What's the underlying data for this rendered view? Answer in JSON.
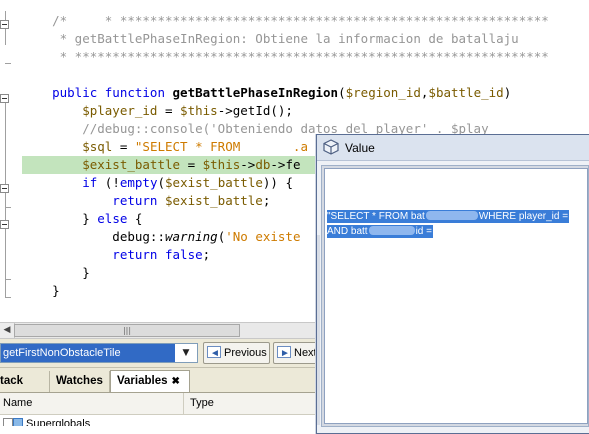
{
  "editor": {
    "lines": [
      {
        "tokens": [
          {
            "c": "cm",
            "t": "    /*     * ********************************************************************"
          }
        ]
      },
      {
        "tokens": [
          {
            "c": "cm",
            "t": "     * getBattlePhaseInRegion: Obtiene la informacion de batallaju"
          }
        ]
      },
      {
        "tokens": [
          {
            "c": "cm",
            "t": "     * ********************************************************************"
          }
        ]
      },
      {
        "tokens": [
          {
            "c": "pl",
            "t": ""
          }
        ]
      },
      {
        "tokens": [
          {
            "c": "kw",
            "t": "    public function "
          },
          {
            "c": "fn",
            "t": "getBattlePhaseInRegion"
          },
          {
            "c": "pl",
            "t": "("
          },
          {
            "c": "var",
            "t": "$region_id"
          },
          {
            "c": "pl",
            "t": ","
          },
          {
            "c": "var",
            "t": "$battle_id"
          },
          {
            "c": "pl",
            "t": ")"
          }
        ]
      },
      {
        "tokens": [
          {
            "c": "var",
            "t": "        $player_id"
          },
          {
            "c": "pl",
            "t": " = "
          },
          {
            "c": "var",
            "t": "$this"
          },
          {
            "c": "pl",
            "t": "->getId();"
          }
        ]
      },
      {
        "tokens": [
          {
            "c": "cm",
            "t": "        //debug::console('Obteniendo datos del player' . $play"
          }
        ]
      },
      {
        "tokens": [
          {
            "c": "var",
            "t": "        $sql"
          },
          {
            "c": "pl",
            "t": " = "
          },
          {
            "c": "str",
            "t": "\"SELECT * FROM       .a"
          }
        ]
      },
      {
        "hl": true,
        "tokens": [
          {
            "c": "var",
            "t": "        $exist_battle"
          },
          {
            "c": "pl",
            "t": " = "
          },
          {
            "c": "var",
            "t": "$this"
          },
          {
            "c": "pl",
            "t": "->"
          },
          {
            "c": "var",
            "t": "db"
          },
          {
            "c": "pl",
            "t": "->fe"
          }
        ]
      },
      {
        "tokens": [
          {
            "c": "kw",
            "t": "        if "
          },
          {
            "c": "pl",
            "t": "(!"
          },
          {
            "c": "kw",
            "t": "empty"
          },
          {
            "c": "pl",
            "t": "("
          },
          {
            "c": "var",
            "t": "$exist_battle"
          },
          {
            "c": "pl",
            "t": ")) {"
          }
        ]
      },
      {
        "tokens": [
          {
            "c": "kw",
            "t": "            return "
          },
          {
            "c": "var",
            "t": "$exist_battle"
          },
          {
            "c": "pl",
            "t": ";"
          }
        ]
      },
      {
        "tokens": [
          {
            "c": "pl",
            "t": "        } "
          },
          {
            "c": "kw",
            "t": "else"
          },
          {
            "c": "pl",
            "t": " {"
          }
        ]
      },
      {
        "tokens": [
          {
            "c": "pl",
            "t": "            debug::"
          },
          {
            "c": "it",
            "t": "warning"
          },
          {
            "c": "pl",
            "t": "("
          },
          {
            "c": "str",
            "t": "'No existe"
          }
        ]
      },
      {
        "tokens": [
          {
            "c": "kw",
            "t": "            return false"
          },
          {
            "c": "pl",
            "t": ";"
          }
        ]
      },
      {
        "tokens": [
          {
            "c": "pl",
            "t": "        }"
          }
        ]
      },
      {
        "tokens": [
          {
            "c": "pl",
            "t": "    }"
          }
        ]
      }
    ]
  },
  "navbar": {
    "method": "getFirstNonObstacleTile",
    "previous_label": "Previous",
    "next_label": "Next"
  },
  "panel": {
    "tabs": [
      "tack",
      "Watches",
      "Variables"
    ],
    "columns": {
      "name": "Name",
      "type": "Type"
    },
    "rows": [
      {
        "label": "Superglobals"
      }
    ]
  },
  "dialog": {
    "title": "Value",
    "line1_start": "\"SELECT * FROM bat",
    "line1_end": "WHERE player_id =",
    "line2_start": "AND batt",
    "line2_end": "id ="
  },
  "colors": {
    "highlight_line": "#c3e4bd",
    "selection": "#3a7dd8",
    "combo_selection": "#316ac5"
  }
}
